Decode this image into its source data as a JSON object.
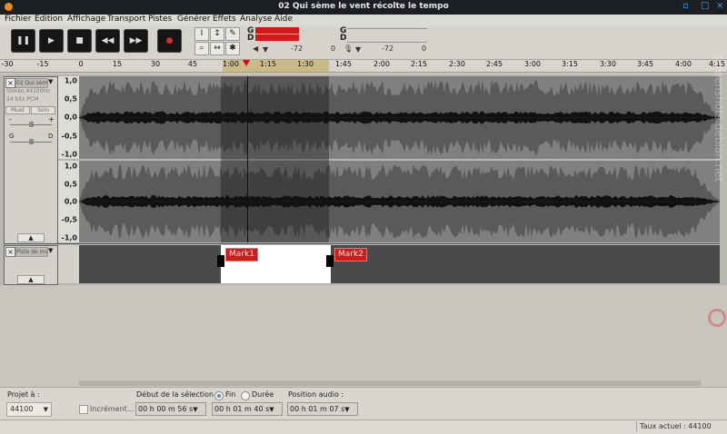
{
  "window": {
    "title": "02 Qui sème le vent récolte le tempo",
    "controls": [
      "▫",
      "□",
      "×"
    ]
  },
  "menu": [
    "Fichier",
    "Edition",
    "Affichage",
    "Transport",
    "Pistes",
    "Générer",
    "Effets",
    "Analyse",
    "Aide"
  ],
  "transport": {
    "pause": "❚❚",
    "play": "▶",
    "stop": "■",
    "rewind": "◀◀",
    "forward": "▶▶",
    "record": "●"
  },
  "tools": {
    "select": "I",
    "envelope": "↕",
    "draw": "✎",
    "zoom": "⌕",
    "timeshift": "↔",
    "multi": "✱"
  },
  "meters": {
    "play_left": "G",
    "play_right": "D",
    "rec_left": "G",
    "rec_right": "D",
    "play_scale": [
      "-72",
      "0"
    ],
    "rec_scale": [
      "-72",
      "0"
    ],
    "play_level": 0.55,
    "colors": {
      "play": "#d21818"
    }
  },
  "ruler": {
    "ticks": [
      "-30",
      "-15",
      "0",
      "15",
      "30",
      "45",
      "1:00",
      "1:15",
      "1:30",
      "1:45",
      "2:00",
      "2:15",
      "2:30",
      "2:45",
      "3:00",
      "3:15",
      "3:30",
      "3:45",
      "4:00",
      "4:15"
    ]
  },
  "audio_track": {
    "name": "02 Qui sèm",
    "format": "Stéréo,44100Hz",
    "bits": "24 bits PCM",
    "mute": "Muet",
    "solo": "Solo",
    "gain_minus": "-",
    "gain_plus": "+",
    "pan_left": "G",
    "pan_right": "D",
    "close": "×",
    "collapse": "▲",
    "dropdown": "▼",
    "scale": [
      "1,0",
      "0,5",
      "0,0",
      "-0,5",
      "-1,0"
    ]
  },
  "label_track": {
    "name": "Piste de ma",
    "close": "×",
    "dropdown": "▼",
    "collapse": "▲",
    "marks": [
      "Mark1",
      "Mark2"
    ]
  },
  "selection_toolbar": {
    "project_label": "Projet à :",
    "project_rate": "44100",
    "snap_label": "Incrément...",
    "start_label": "Début de la sélection",
    "end_option": "Fin",
    "duration_option": "Durée",
    "position_label": "Position audio :",
    "start_time": "00 h 00 m 56 s",
    "end_time": "00 h 01 m 40 s",
    "position_time": "00 h 01 m 07 s"
  },
  "status": {
    "rate": "Taux actuel : 44100"
  },
  "watermark": "screenshots.debian.net"
}
